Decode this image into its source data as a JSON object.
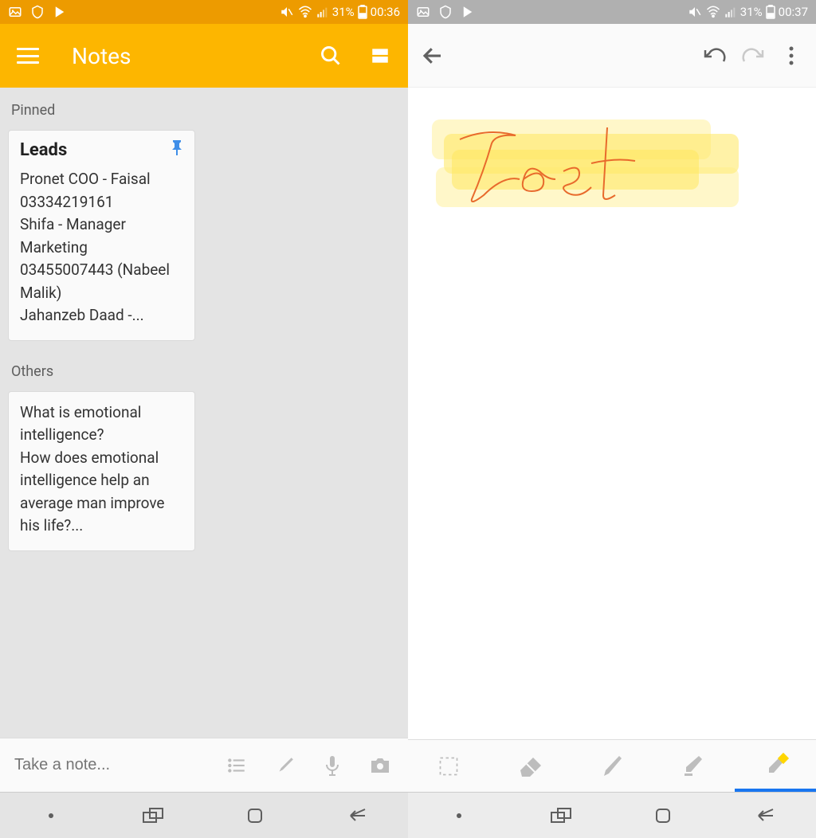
{
  "left": {
    "status": {
      "time": "00:36",
      "battery": "31%"
    },
    "appbar": {
      "title": "Notes"
    },
    "sections": {
      "pinned_label": "Pinned",
      "others_label": "Others"
    },
    "pinned_note": {
      "title": "Leads",
      "body": "Pronet COO - Faisal 03334219161\nShifa - Manager Marketing 03455007443 (Nabeel Malik)\nJahanzeb Daad -..."
    },
    "other_note": {
      "body": "What is emotional intelligence?\nHow does emotional intelligence help an average man improve his life?..."
    },
    "compose_placeholder": "Take a note..."
  },
  "right": {
    "status": {
      "time": "00:37",
      "battery": "31%"
    },
    "drawn_word": "Test",
    "tools": {
      "select": "select-tool",
      "eraser": "eraser-tool",
      "pen": "pen-tool",
      "marker": "marker-tool",
      "highlighter": "highlighter-tool"
    }
  },
  "icons": {
    "hamburger": "hamburger-icon",
    "search": "search-icon",
    "view_toggle": "view-toggle-icon",
    "list": "list-icon",
    "brush": "brush-icon",
    "mic": "mic-icon",
    "camera": "camera-icon",
    "back": "back-icon",
    "undo": "undo-icon",
    "redo": "redo-icon",
    "overflow": "overflow-icon",
    "nav_recent": "nav-recent-icon",
    "nav_home": "nav-home-icon",
    "nav_back": "nav-back-icon",
    "nav_dot": "nav-dot-icon",
    "image": "image-icon",
    "shield": "shield-icon",
    "play": "play-icon",
    "mute": "mute-icon",
    "wifi": "wifi-icon",
    "signal": "signal-icon",
    "battery_icon": "battery-icon"
  }
}
